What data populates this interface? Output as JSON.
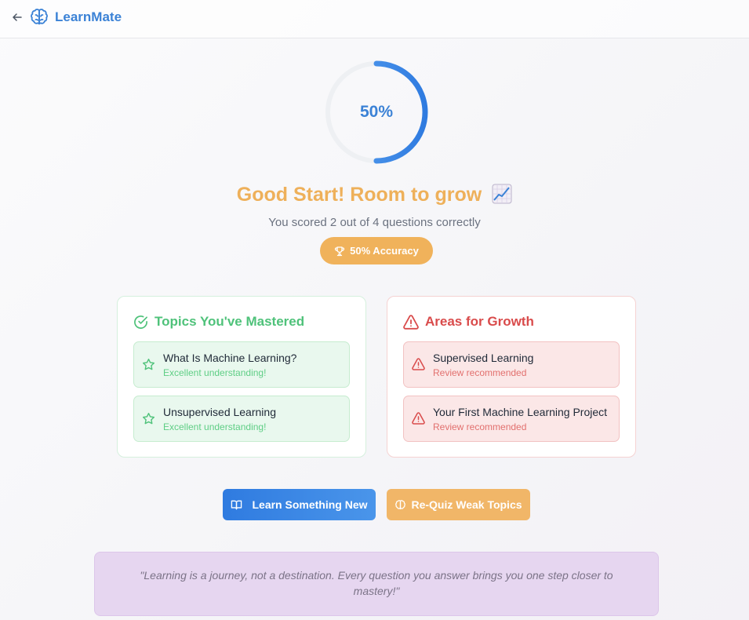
{
  "header": {
    "brand": "LearnMate",
    "back_icon": "arrow-left-icon",
    "logo_icon": "brain-icon"
  },
  "result": {
    "percent_label": "50%",
    "progress_fraction": 0.5,
    "headline": "Good Start! Room to grow",
    "headline_icon": "chart-increasing-emoji",
    "summary": "You scored 2 out of 4 questions correctly",
    "accuracy_label": "50% Accuracy",
    "accuracy_icon": "trophy-icon"
  },
  "mastered": {
    "title": "Topics You've Mastered",
    "title_icon": "check-circle-icon",
    "item_icon": "star-icon",
    "items": [
      {
        "name": "What Is Machine Learning?",
        "note": "Excellent understanding!"
      },
      {
        "name": "Unsupervised Learning",
        "note": "Excellent understanding!"
      }
    ]
  },
  "growth": {
    "title": "Areas for Growth",
    "title_icon": "warning-triangle-icon",
    "item_icon": "warning-triangle-icon",
    "items": [
      {
        "name": "Supervised Learning",
        "note": "Review recommended"
      },
      {
        "name": "Your First Machine Learning Project",
        "note": "Review recommended"
      }
    ]
  },
  "actions": {
    "learn_label": "Learn Something New",
    "learn_icon": "book-open-icon",
    "requiz_label": "Re-Quiz Weak Topics",
    "requiz_icon": "brain-icon"
  },
  "quote": "\"Learning is a journey, not a destination. Every question you answer brings you one step closer to mastery!\"",
  "colors": {
    "brand_blue": "#3b82d6",
    "accent_orange": "#f0b25b",
    "success_green": "#4fc27a",
    "danger_red": "#d94b4b",
    "quote_bg": "#e6d6f0"
  }
}
